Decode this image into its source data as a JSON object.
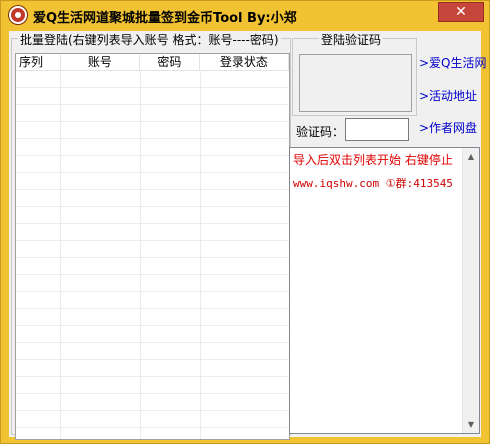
{
  "window": {
    "title": "爱Q生活网道聚城批量签到金币Tool    By:小郑",
    "close_glyph": "✕"
  },
  "account_group": {
    "legend": "批量登陆(右键列表导入账号 格式：账号----密码)",
    "columns": [
      "序列",
      "账号",
      "密码",
      "登录状态"
    ]
  },
  "captcha_group": {
    "legend": "登陆验证码",
    "input_label": "验证码：",
    "input_value": ""
  },
  "links": [
    {
      "label": ">爱Q生活网"
    },
    {
      "label": ">活动地址"
    },
    {
      "label": ">作者网盘"
    }
  ],
  "log": {
    "line1": "导入后双击列表开始 右键停止",
    "line2": "www.iqshw.com ①群:413545"
  },
  "colors": {
    "title_bar": "#f1c232",
    "close_button": "#c7463c",
    "link": "#0000cc",
    "log_text": "#e00000"
  },
  "icons": {
    "app": "app-logo-icon",
    "close": "close-icon",
    "scroll_up": "scroll-up-arrow-icon",
    "scroll_down": "scroll-down-arrow-icon"
  }
}
